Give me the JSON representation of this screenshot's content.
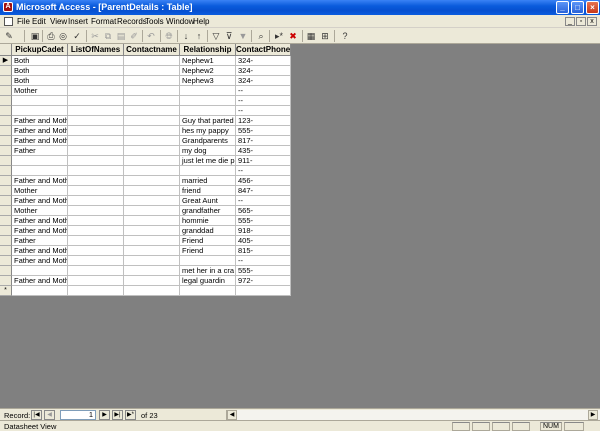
{
  "window": {
    "title": "Microsoft Access - [ParentDetails : Table]",
    "app_icon_letter": "A"
  },
  "menubar": {
    "items": [
      "File",
      "Edit",
      "View",
      "Insert",
      "Format",
      "Records",
      "Tools",
      "Window",
      "Help"
    ]
  },
  "toolbar": {
    "icons": [
      "design-view-icon",
      "save-icon",
      "print-icon",
      "print-preview-icon",
      "spelling-icon",
      "cut-icon",
      "copy-icon",
      "paste-icon",
      "format-painter-icon",
      "undo-icon",
      "insert-hyperlink-icon",
      "sort-ascending-icon",
      "sort-descending-icon",
      "filter-by-selection-icon",
      "filter-by-form-icon",
      "apply-filter-icon",
      "find-icon",
      "new-record-icon",
      "delete-record-icon",
      "database-window-icon",
      "new-object-icon",
      "help-icon"
    ]
  },
  "table": {
    "columns": [
      "PickupCadet",
      "ListOfNames",
      "Contactname",
      "Relationship",
      "ContactPhone"
    ],
    "rows": [
      {
        "marker": "▶",
        "cells": [
          "Both",
          "",
          "",
          "Nephew1",
          "324-"
        ]
      },
      {
        "marker": "",
        "cells": [
          "Both",
          "",
          "",
          "Nephew2",
          "324-"
        ]
      },
      {
        "marker": "",
        "cells": [
          "Both",
          "",
          "",
          "Nephew3",
          "324-"
        ]
      },
      {
        "marker": "",
        "cells": [
          "Mother",
          "",
          "",
          "",
          "--"
        ]
      },
      {
        "marker": "",
        "cells": [
          "",
          "",
          "",
          "",
          "--"
        ]
      },
      {
        "marker": "",
        "cells": [
          "",
          "",
          "",
          "",
          "--"
        ]
      },
      {
        "marker": "",
        "cells": [
          "Father and Moth",
          "",
          "",
          "Guy that parted",
          "123-"
        ]
      },
      {
        "marker": "",
        "cells": [
          "Father and Moth",
          "",
          "",
          "hes my pappy",
          "555-"
        ]
      },
      {
        "marker": "",
        "cells": [
          "Father and Moth",
          "",
          "",
          "Grandparents",
          "817-"
        ]
      },
      {
        "marker": "",
        "cells": [
          "Father",
          "",
          "",
          "my dog",
          "435-"
        ]
      },
      {
        "marker": "",
        "cells": [
          "",
          "",
          "",
          "just let me die p",
          "911-"
        ]
      },
      {
        "marker": "",
        "cells": [
          "",
          "",
          "",
          "",
          "--"
        ]
      },
      {
        "marker": "",
        "cells": [
          "Father and Moth",
          "",
          "",
          "married",
          "456-"
        ]
      },
      {
        "marker": "",
        "cells": [
          "Mother",
          "",
          "",
          "friend",
          "847-"
        ]
      },
      {
        "marker": "",
        "cells": [
          "Father and Moth",
          "",
          "",
          "Great Aunt",
          "--"
        ]
      },
      {
        "marker": "",
        "cells": [
          "Mother",
          "",
          "",
          "grandfather",
          "565-"
        ]
      },
      {
        "marker": "",
        "cells": [
          "Father and Moth",
          "",
          "",
          "hommie",
          "555-"
        ]
      },
      {
        "marker": "",
        "cells": [
          "Father and Moth",
          "",
          "",
          "granddad",
          "918-"
        ]
      },
      {
        "marker": "",
        "cells": [
          "Father",
          "",
          "",
          "Friend",
          "405-"
        ]
      },
      {
        "marker": "",
        "cells": [
          "Father and Moth",
          "",
          "",
          "Friend",
          "815-"
        ]
      },
      {
        "marker": "",
        "cells": [
          "Father and Moth",
          "",
          "",
          "",
          "--"
        ]
      },
      {
        "marker": "",
        "cells": [
          "",
          "",
          "",
          "met her in a cra",
          "555-"
        ]
      },
      {
        "marker": "",
        "cells": [
          "Father and Moth",
          "",
          "",
          "legal guardin",
          "972-"
        ]
      },
      {
        "marker": "*",
        "cells": [
          "",
          "",
          "",
          "",
          ""
        ]
      }
    ]
  },
  "navigation": {
    "label": "Record:",
    "current_record": "1",
    "of_text": "of 23"
  },
  "status": {
    "text": "Datasheet View",
    "num_indicator": "NUM"
  }
}
